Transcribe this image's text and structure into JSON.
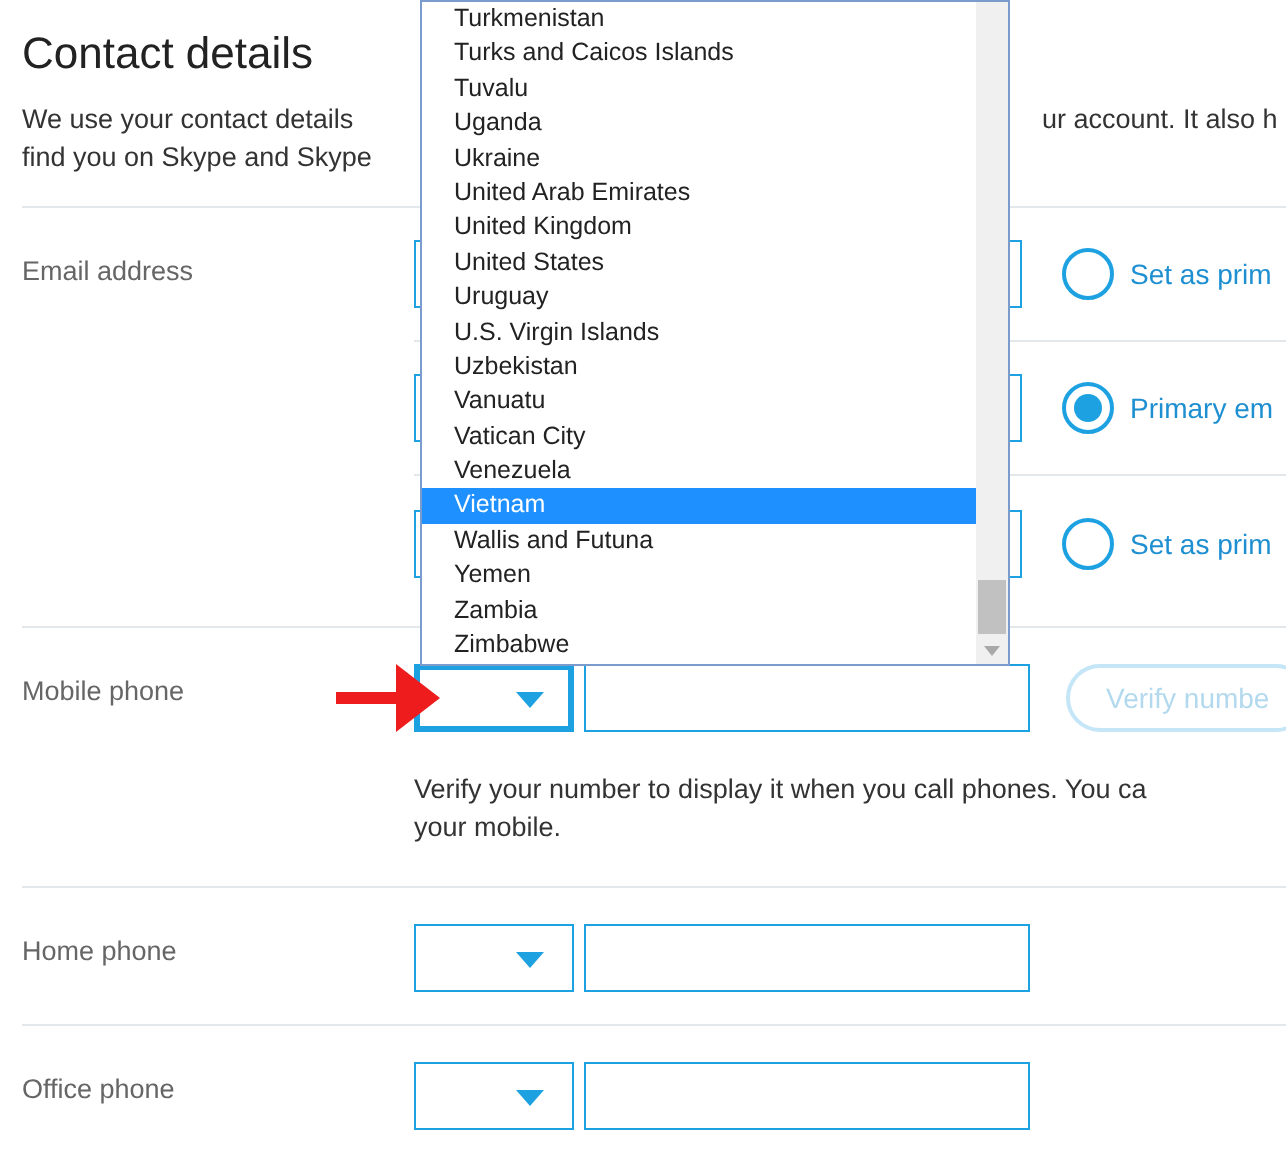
{
  "title": "Contact details",
  "intro": {
    "left_lines": [
      "We use your contact details",
      "find you on Skype and Skype"
    ],
    "right_line": "ur account. It also h"
  },
  "email": {
    "label": "Email address",
    "rows": [
      {
        "option": "Set as prim",
        "selected": false
      },
      {
        "option": "Primary em",
        "selected": true
      },
      {
        "option": "Set as prim",
        "selected": false
      }
    ]
  },
  "mobile": {
    "label": "Mobile phone",
    "focused": true,
    "verify_button": "Verify numbe",
    "help_lines": [
      "Verify your number to display it when you call phones. You ca",
      "your mobile."
    ]
  },
  "phones": [
    {
      "label": "Home phone",
      "focused": false
    },
    {
      "label": "Office phone",
      "focused": false
    }
  ],
  "country_list": [
    {
      "name": "Turkmenistan",
      "selected": false
    },
    {
      "name": "Turks and Caicos Islands",
      "selected": false
    },
    {
      "name": "Tuvalu",
      "selected": false
    },
    {
      "name": "Uganda",
      "selected": false
    },
    {
      "name": "Ukraine",
      "selected": false
    },
    {
      "name": "United Arab Emirates",
      "selected": false
    },
    {
      "name": "United Kingdom",
      "selected": false
    },
    {
      "name": "United States",
      "selected": false
    },
    {
      "name": "Uruguay",
      "selected": false
    },
    {
      "name": "U.S. Virgin Islands",
      "selected": false
    },
    {
      "name": "Uzbekistan",
      "selected": false
    },
    {
      "name": "Vanuatu",
      "selected": false
    },
    {
      "name": "Vatican City",
      "selected": false
    },
    {
      "name": "Venezuela",
      "selected": false
    },
    {
      "name": "Vietnam",
      "selected": true
    },
    {
      "name": "Wallis and Futuna",
      "selected": false
    },
    {
      "name": "Yemen",
      "selected": false
    },
    {
      "name": "Zambia",
      "selected": false
    },
    {
      "name": "Zimbabwe",
      "selected": false
    }
  ]
}
